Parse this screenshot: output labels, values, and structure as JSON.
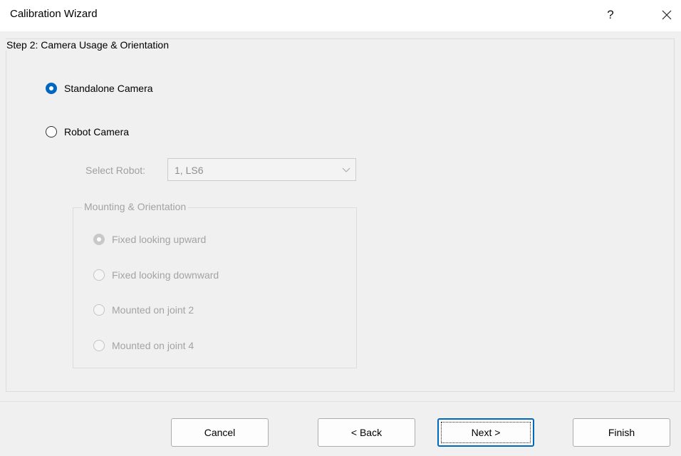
{
  "window": {
    "title": "Calibration Wizard",
    "help_label": "?",
    "close_icon": "close-icon"
  },
  "step": {
    "legend": "Step 2: Camera Usage & Orientation",
    "usage_options": [
      {
        "label": "Standalone Camera",
        "checked": true,
        "enabled": true
      },
      {
        "label": "Robot Camera",
        "checked": false,
        "enabled": true
      }
    ],
    "select_robot": {
      "label": "Select Robot:",
      "value": "1, LS6",
      "enabled": false
    },
    "mounting": {
      "legend": "Mounting & Orientation",
      "options": [
        {
          "label": "Fixed looking upward",
          "checked": true,
          "enabled": false
        },
        {
          "label": "Fixed looking downward",
          "checked": false,
          "enabled": false
        },
        {
          "label": "Mounted on joint 2",
          "checked": false,
          "enabled": false
        },
        {
          "label": "Mounted on joint 4",
          "checked": false,
          "enabled": false
        }
      ]
    }
  },
  "buttons": {
    "cancel": "Cancel",
    "back": "< Back",
    "next": "Next >",
    "finish": "Finish"
  },
  "colors": {
    "accent": "#0067c0",
    "dialog_bg": "#f0f0f0",
    "disabled_text": "#a3a3a3"
  }
}
